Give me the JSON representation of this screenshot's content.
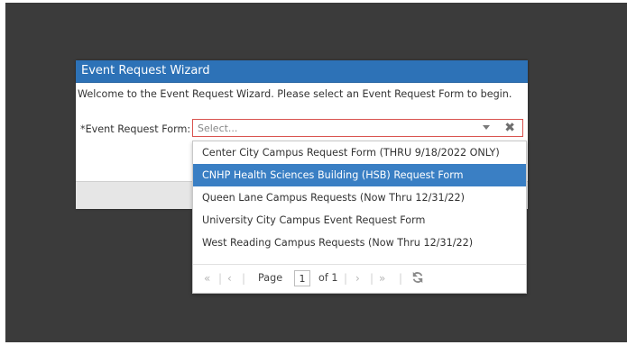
{
  "dialog": {
    "title": "Event Request Wizard",
    "welcome": "Welcome to the Event Request Wizard. Please select an Event Request Form to begin.",
    "field_label": "*Event Request Form:",
    "select_placeholder": "Select...",
    "clear_symbol": "✖"
  },
  "dropdown": {
    "options": [
      "Center City Campus Request Form (THRU 9/18/2022 ONLY)",
      "CNHP Health Sciences Building (HSB) Request Form",
      "Queen Lane Campus Requests (Now Thru 12/31/22)",
      "University City Campus Event Request Form",
      "West Reading Campus Requests (Now Thru 12/31/22)"
    ],
    "highlighted_index": 1,
    "pager": {
      "first": "«",
      "prev": "‹",
      "page_label": "Page",
      "page_value": "1",
      "of_label": "of 1",
      "next": "›",
      "last": "»",
      "separator": "|"
    }
  },
  "colors": {
    "header": "#2d72b7",
    "highlight": "#3a7fc4",
    "invalid_border": "#d9534f",
    "backdrop": "#3b3b3b"
  }
}
